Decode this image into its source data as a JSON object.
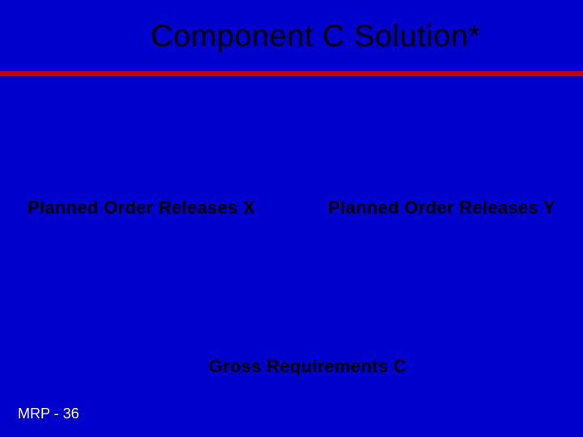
{
  "title": "Component C Solution*",
  "labels": {
    "left": "Planned Order Releases X",
    "right": "Planned Order Releases Y",
    "bottom": "Gross Requirements C"
  },
  "footer": "MRP - 36"
}
